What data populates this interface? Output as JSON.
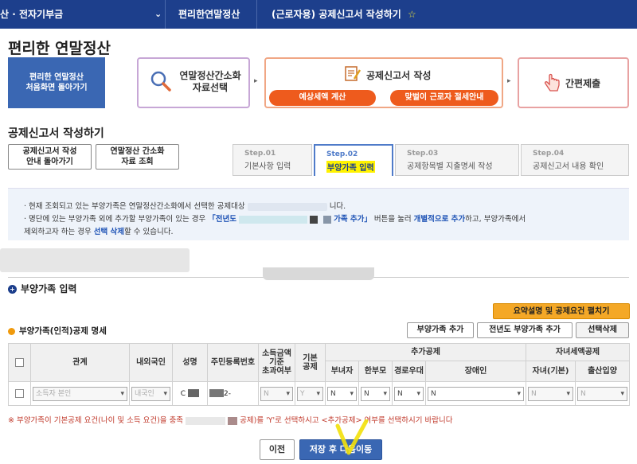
{
  "nav": {
    "crumb1": "산 · 전자기부금",
    "crumb2": "편리한연말정산",
    "crumb3": "(근로자용) 공제신고서 작성하기",
    "star": "☆"
  },
  "page_title": "편리한 연말정산",
  "process": {
    "home_line1": "편리한 연말정산",
    "home_line2": "처음화면 돌아가기",
    "step1_line1": "연말정산간소화",
    "step1_line2": "자료선택",
    "step2_label": "공제신고서 작성",
    "step2_pill1": "예상세액 계산",
    "step2_pill2": "맞벌이 근로자 절세안내",
    "step3_label": "간편제출",
    "arrow": "▸"
  },
  "section_title": "공제신고서 작성하기",
  "sub_buttons": {
    "guide_line1": "공제신고서 작성",
    "guide_line2": "안내 돌아가기",
    "lookup_line1": "연말정산 간소화",
    "lookup_line2": "자료 조회"
  },
  "tabs": [
    {
      "num": "Step.01",
      "name": "기본사항 입력"
    },
    {
      "num": "Step.02",
      "name": "부양가족 입력"
    },
    {
      "num": "Step.03",
      "name": "공제항목별 지출명세 작성"
    },
    {
      "num": "Step.04",
      "name": "공제신고서 내용 확인"
    }
  ],
  "info": {
    "line1_a": "· 현재 조회되고 있는 부양가족은 연말정산간소화에서 선택한 공제대상",
    "line1_b": "니다.",
    "line2_a": "· 명단에 있는 부양가족 외에 추가할 부양가족이 있는 경우",
    "line2_b": "「전년도",
    "line2_c": "가족 추가」",
    "line2_d": "버튼을 눌러",
    "line2_e": "개별적으로 추가",
    "line2_f": "하고, 부양가족에서",
    "line3_a": "제외하고자 하는 경우",
    "line3_b": "선택 삭제",
    "line3_c": "할 수 있습니다."
  },
  "panel_title": "부양가족 입력",
  "panel_icon": "+",
  "summary_button": "요약설명 및 공제요건 펼치기",
  "table_title": "부양가족(인적)공제 명세",
  "actions": {
    "add": "부양가족 추가",
    "prev_add": "전년도 부양가족 추가",
    "delete": "선택삭제"
  },
  "table": {
    "headers": {
      "relation": "관계",
      "nationality": "내외국인",
      "name": "성명",
      "ssn": "주민등록번호",
      "income_1": "소득금액",
      "income_2": "기준",
      "income_3": "초과여부",
      "basic_1": "기본",
      "basic_2": "공제",
      "additional": "추가공제",
      "child_tax": "자녀세액공제",
      "woman": "부녀자",
      "single_parent": "한부모",
      "elderly": "경로우대",
      "disabled": "장애인",
      "child_basic": "자녀(기본)",
      "birth_adopt": "출산입양"
    },
    "row": {
      "relation": "소득자 본인",
      "nationality": "내국인",
      "name": "C",
      "ssn": "2-",
      "income_over": "N",
      "basic": "Y",
      "woman": "N",
      "single_parent": "N",
      "elderly": "N",
      "disabled": "N",
      "child_basic": "N",
      "birth_adopt": "N"
    }
  },
  "note": {
    "a": "※ 부양가족이 기본공제 요건(나이 및 소득 요건)을 충족",
    "b": "공제)를 'Y'로 선택하시고 <추가공제> 여부를 선택하시기 바랍니다"
  },
  "footer": {
    "prev": "이전",
    "save_next": "저장 후 다음이동"
  },
  "colors": {
    "nav_bg": "#1d3f8c",
    "accent_orange": "#ee5b1d",
    "summary_btn": "#f4a827",
    "primary_btn": "#3a67b3",
    "highlight": "#fff200",
    "check_mark": "#f2e00a"
  }
}
